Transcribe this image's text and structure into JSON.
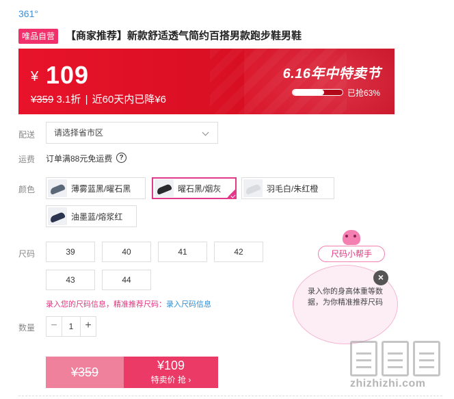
{
  "brand": "361°",
  "badge": "唯品自营",
  "product_title": "【商家推荐】新款舒适透气简约百搭男款跑步鞋男鞋",
  "price": {
    "currency": "¥",
    "now": "109",
    "old": "¥359",
    "discount": "3.1折",
    "separator": "|",
    "history": "近60天内已降¥6"
  },
  "promo": {
    "title": "6.16年中特卖节",
    "progress_percent": 63,
    "progress_label": "已抢63%",
    "colors": {
      "banner": "#e8132a",
      "accent": "#e4398a"
    }
  },
  "delivery": {
    "label": "配送",
    "placeholder": "请选择省市区",
    "chevron_icon": "chevron-down-icon"
  },
  "shipping": {
    "label": "运费",
    "text": "订单满88元免运费",
    "help_icon": "?"
  },
  "colors": {
    "label": "颜色",
    "options": [
      {
        "name": "薄雾蓝黑/曜石黑",
        "selected": false
      },
      {
        "name": "曜石黑/烟灰",
        "selected": true
      },
      {
        "name": "羽毛白/朱红橙",
        "selected": false
      },
      {
        "name": "油墨蓝/熔浆红",
        "selected": false
      }
    ]
  },
  "sizes": {
    "label": "尺码",
    "options": [
      "39",
      "40",
      "41",
      "42",
      "43",
      "44"
    ],
    "info_text": "录入您的尺码信息，精准推荐尺码：",
    "info_link": "录入尺码信息"
  },
  "quantity": {
    "label": "数量",
    "minus": "−",
    "value": "1",
    "plus": "+"
  },
  "buy": {
    "old_price": "¥359",
    "price": "¥109",
    "label": "特卖价 抢 ›"
  },
  "size_helper": {
    "tab": "尺码小帮手",
    "bubble": "录入你的身高体重等数据，为你精准推荐尺码",
    "close": "×"
  },
  "watermark": {
    "url": "zhizhizhi.com"
  }
}
